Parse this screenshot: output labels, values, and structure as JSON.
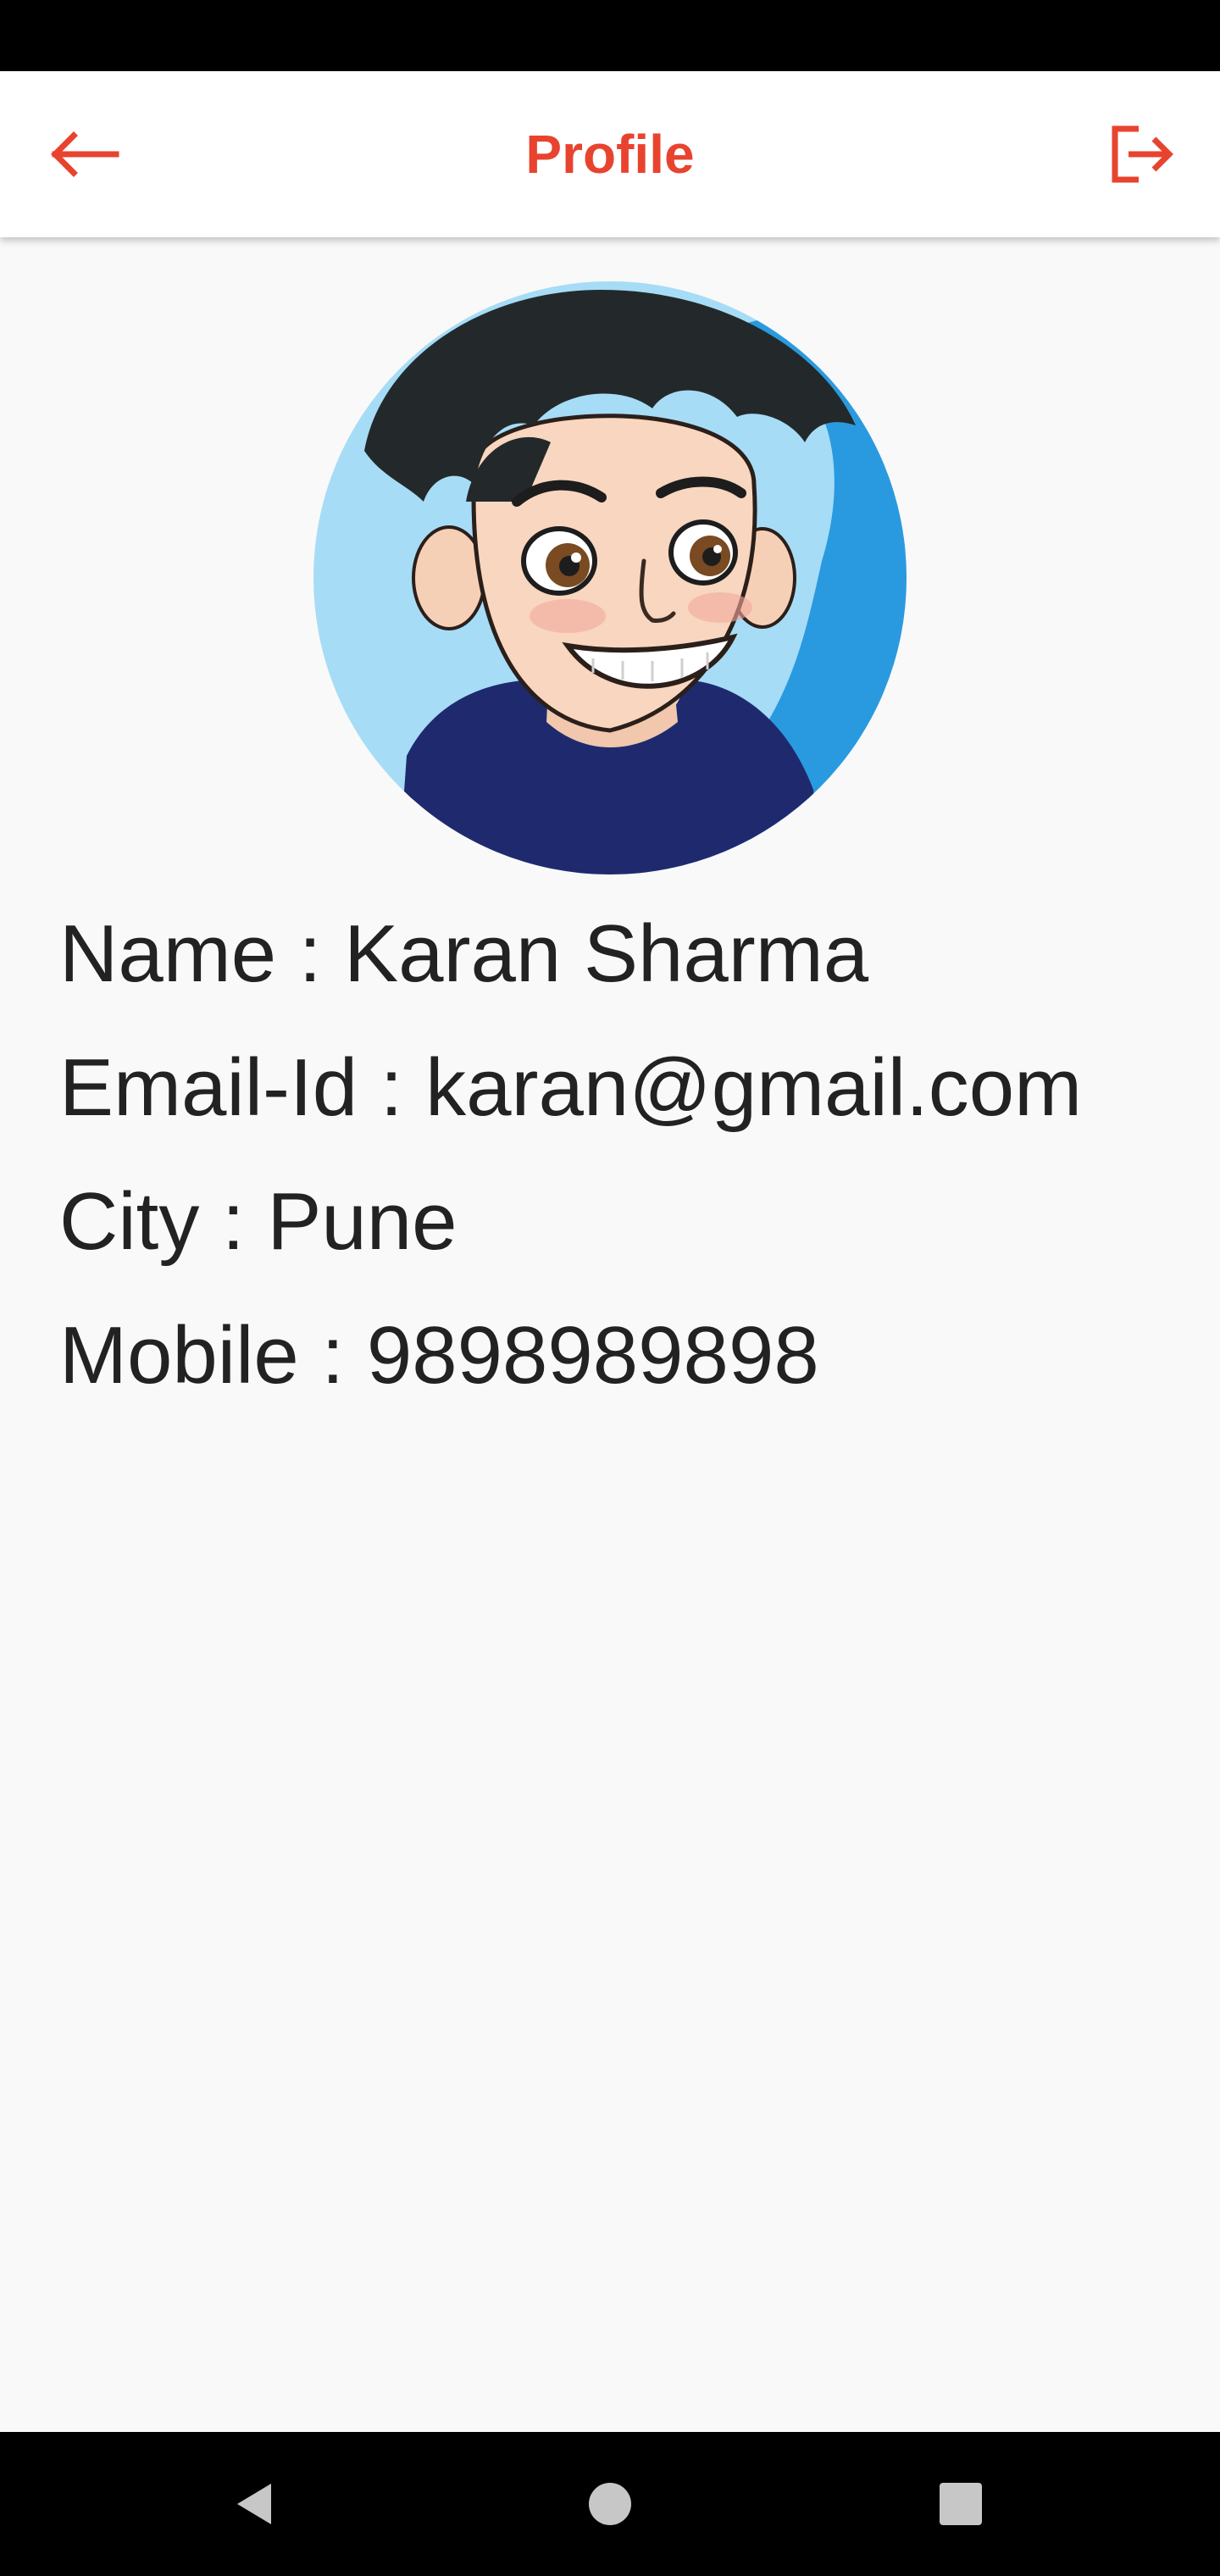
{
  "app_bar": {
    "title": "Profile",
    "back_icon": "arrow-left-icon",
    "logout_icon": "logout-icon",
    "accent_color": "#e8432f"
  },
  "profile": {
    "avatar_icon": "avatar-illustration",
    "name_line": "Name : Karan Sharma",
    "email_line": "Email-Id : karan@gmail.com",
    "city_line": "City : Pune",
    "mobile_line": "Mobile : 9898989898"
  },
  "nav_bar": {
    "back_icon": "triangle-back-icon",
    "home_icon": "circle-home-icon",
    "recents_icon": "square-recents-icon"
  },
  "colors": {
    "background": "#f9f9f9",
    "text": "#222222",
    "system_bars": "#000000"
  }
}
